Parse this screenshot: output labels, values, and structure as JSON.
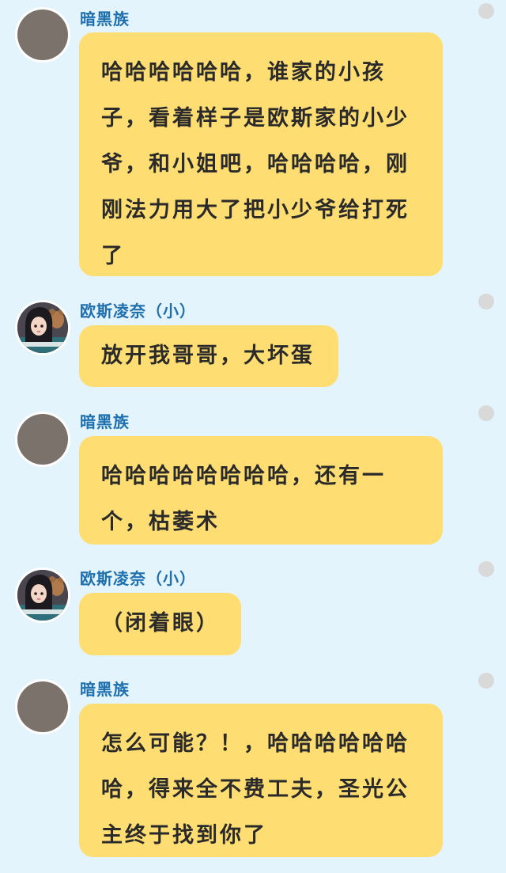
{
  "chat": {
    "messages": [
      {
        "sender": "暗黑族",
        "avatar": "blank-avatar",
        "lines": [
          "哈哈哈哈哈哈，谁家的小孩",
          "子，看着样子是欧斯家的小少",
          "爷，和小姐吧，哈哈哈哈，刚",
          "刚法力用大了把小少爷给打死",
          "了"
        ]
      },
      {
        "sender": "欧斯凌奈（小）",
        "avatar": "girl-photo-avatar",
        "lines": [
          "放开我哥哥，大坏蛋"
        ]
      },
      {
        "sender": "暗黑族",
        "avatar": "blank-avatar",
        "lines": [
          "哈哈哈哈哈哈哈哈，还有一",
          "个，枯萎术"
        ]
      },
      {
        "sender": "欧斯凌奈（小）",
        "avatar": "girl-photo-avatar",
        "lines": [
          "（闭着眼）"
        ]
      },
      {
        "sender": "暗黑族",
        "avatar": "blank-avatar",
        "lines": [
          "怎么可能？！，哈哈哈哈哈哈",
          "哈，得来全不费工夫，圣光公",
          "主终于找到你了"
        ]
      }
    ]
  },
  "colors": {
    "background": "#e4f4fc",
    "bubble": "#fedd72",
    "sender_name": "#1e6fae",
    "bubble_text": "#2a2a2a",
    "dot": "#d9d9d9"
  }
}
